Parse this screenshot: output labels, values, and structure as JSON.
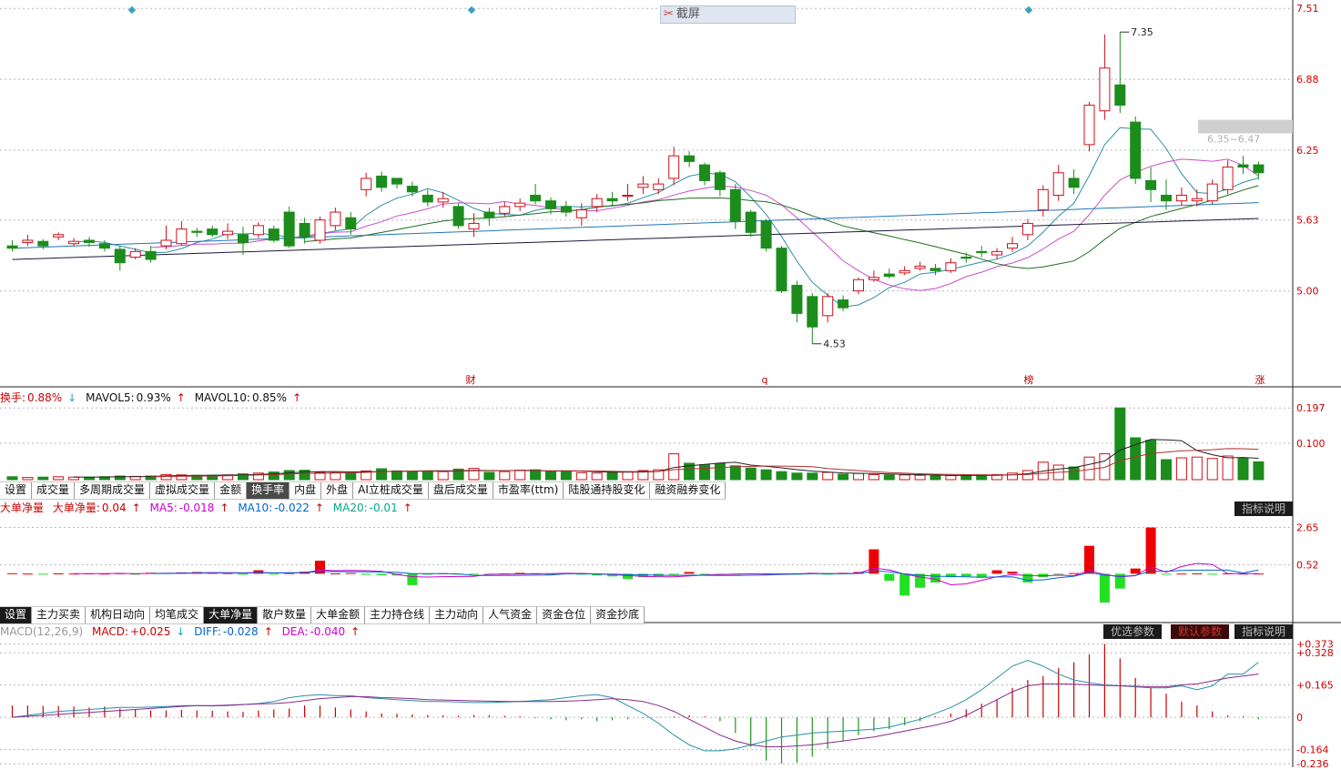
{
  "colors": {
    "up": "#d10f1a",
    "down": "#1c8c1c",
    "ma5": "#2e8fa6",
    "ma10": "#c94fc9",
    "ma20": "#1e6f1e",
    "ma60": "#2276b8",
    "ma120": "#1a1a3a",
    "grid": "#b8b8b8",
    "gray_band": "#cfcfcf"
  },
  "price_panel": {
    "y_ticks": [
      "7.51",
      "6.88",
      "6.25",
      "5.63",
      "5.00"
    ],
    "ylim": [
      4.35,
      7.52
    ],
    "high_label": "7.35",
    "low_label": "4.53",
    "range_label": "6.35~6.47",
    "event_markers": [
      "财",
      "q",
      "榜",
      "涨"
    ],
    "screenshot_button": "截屏"
  },
  "turnover_panel": {
    "legend": {
      "name": "换手:",
      "value": "0.88%",
      "arrow_value": "↓",
      "ma5_label": "MAVOL5:",
      "ma5_value": "0.93%",
      "ma5_arrow": "↑",
      "ma10_label": "MAVOL10:",
      "ma10_value": "0.85%",
      "ma10_arrow": "↑"
    },
    "y_ticks": [
      "0.197",
      "0.100"
    ],
    "ylim": [
      0,
      0.2
    ]
  },
  "tabs1": [
    "设置",
    "成交量",
    "多周期成交量",
    "虚拟成交量",
    "金额",
    "换手率",
    "内盘",
    "外盘",
    "AI立桩成交量",
    "盘后成交量",
    "市盈率(ttm)",
    "陆股通持股变化",
    "融资融券变化"
  ],
  "tabs1_active": 5,
  "netflow_panel": {
    "legend": {
      "name": "大单净量",
      "sub": "大单净量:",
      "value": "0.04",
      "arrow": "↑",
      "ma5_label": "MA5:",
      "ma5_value": "-0.018",
      "ma5_arrow": "↑",
      "ma10_label": "MA10:",
      "ma10_value": "-0.022",
      "ma10_arrow": "↑",
      "ma20_label": "MA20:",
      "ma20_value": "-0.01",
      "ma20_arrow": "↑"
    },
    "y_ticks": [
      "2.65",
      "0.52"
    ],
    "ylim": [
      -1.7,
      3.2
    ],
    "help_button": "指标说明"
  },
  "tabs2": [
    "设置",
    "主力买卖",
    "机构日动向",
    "均笔成交",
    "大单净量",
    "散户数量",
    "大单金额",
    "主力持仓线",
    "主力动向",
    "人气资金",
    "资金仓位",
    "资金抄底"
  ],
  "tabs2_active": 4,
  "macd_panel": {
    "legend": {
      "name": "MACD(12,26,9)",
      "macd_label": "MACD:",
      "macd_value": "+0.025",
      "macd_arrow": "↓",
      "diff_label": "DIFF:",
      "diff_value": "-0.028",
      "diff_arrow": "↑",
      "dea_label": "DEA:",
      "dea_value": "-0.040",
      "dea_arrow": "↑"
    },
    "y_ticks": [
      "+0.373",
      "+0.328",
      "+0.165",
      "0",
      "-0.164",
      "-0.236"
    ],
    "ylim": [
      -0.24,
      0.38
    ],
    "buttons": [
      "优选参数",
      "默认参数",
      "指标说明"
    ]
  },
  "chart_data": {
    "type": "candlestick",
    "x": [
      "d1",
      "d2",
      "d3",
      "d4",
      "d5",
      "d6",
      "d7",
      "d8",
      "d9",
      "d10",
      "d11",
      "d12",
      "d13",
      "d14",
      "d15",
      "d16",
      "d17",
      "d18",
      "d19",
      "d20",
      "d21",
      "d22",
      "d23",
      "d24",
      "d25",
      "d26",
      "d27",
      "d28",
      "d29",
      "d30",
      "d31",
      "d32",
      "d33",
      "d34",
      "d35",
      "d36",
      "d37",
      "d38",
      "d39",
      "d40",
      "d41",
      "d42",
      "d43",
      "d44",
      "d45",
      "d46",
      "d47",
      "d48",
      "d49",
      "d50",
      "d51",
      "d52",
      "d53",
      "d54",
      "d55",
      "d56",
      "d57",
      "d58",
      "d59",
      "d60",
      "d61",
      "d62",
      "d63",
      "d64",
      "d65",
      "d66",
      "d67",
      "d68",
      "d69",
      "d70",
      "d71",
      "d72",
      "d73",
      "d74",
      "d75",
      "d76",
      "d77",
      "d78",
      "d79",
      "d80",
      "d81",
      "d82"
    ],
    "open": [
      5.4,
      5.43,
      5.44,
      5.48,
      5.42,
      5.45,
      5.42,
      5.37,
      5.3,
      5.35,
      5.4,
      5.42,
      5.53,
      5.55,
      5.5,
      5.5,
      5.5,
      5.55,
      5.7,
      5.6,
      5.45,
      5.58,
      5.65,
      5.9,
      6.02,
      6.0,
      5.93,
      5.85,
      5.79,
      5.75,
      5.55,
      5.7,
      5.69,
      5.75,
      5.85,
      5.8,
      5.75,
      5.65,
      5.75,
      5.82,
      5.85,
      5.92,
      5.9,
      6.0,
      6.2,
      6.12,
      6.05,
      5.9,
      5.7,
      5.62,
      5.38,
      5.05,
      4.95,
      4.78,
      4.92,
      5.0,
      5.1,
      5.15,
      5.16,
      5.2,
      5.2,
      5.18,
      5.3,
      5.35,
      5.32,
      5.38,
      5.5,
      5.72,
      5.85,
      6.0,
      6.3,
      6.6,
      6.83,
      6.5,
      5.98,
      5.85,
      5.8,
      5.8,
      5.8,
      5.9,
      6.12,
      6.12
    ],
    "close": [
      5.38,
      5.45,
      5.4,
      5.5,
      5.44,
      5.43,
      5.38,
      5.25,
      5.35,
      5.28,
      5.45,
      5.55,
      5.52,
      5.5,
      5.53,
      5.43,
      5.58,
      5.45,
      5.4,
      5.48,
      5.63,
      5.7,
      5.55,
      6.0,
      5.92,
      5.95,
      5.88,
      5.79,
      5.82,
      5.58,
      5.6,
      5.65,
      5.75,
      5.78,
      5.8,
      5.73,
      5.7,
      5.72,
      5.82,
      5.8,
      5.85,
      5.95,
      5.95,
      6.2,
      6.15,
      5.98,
      5.9,
      5.62,
      5.52,
      5.38,
      5.0,
      4.8,
      4.68,
      4.95,
      4.85,
      5.1,
      5.12,
      5.13,
      5.18,
      5.22,
      5.18,
      5.25,
      5.29,
      5.34,
      5.35,
      5.42,
      5.6,
      5.9,
      6.05,
      5.92,
      6.65,
      6.98,
      6.65,
      6.0,
      5.9,
      5.8,
      5.85,
      5.82,
      5.95,
      6.1,
      6.1,
      6.05
    ],
    "high": [
      5.45,
      5.5,
      5.46,
      5.52,
      5.47,
      5.48,
      5.45,
      5.4,
      5.38,
      5.4,
      5.58,
      5.62,
      5.56,
      5.58,
      5.6,
      5.57,
      5.61,
      5.58,
      5.75,
      5.65,
      5.66,
      5.74,
      5.7,
      6.05,
      6.06,
      6.0,
      5.97,
      5.9,
      5.88,
      5.78,
      5.69,
      5.74,
      5.79,
      5.82,
      5.95,
      5.83,
      5.8,
      5.78,
      5.86,
      5.88,
      5.95,
      6.02,
      6.0,
      6.28,
      6.24,
      6.14,
      6.07,
      5.95,
      5.72,
      5.64,
      5.4,
      5.09,
      4.98,
      4.98,
      4.96,
      5.12,
      5.18,
      5.2,
      5.22,
      5.26,
      5.24,
      5.29,
      5.34,
      5.4,
      5.38,
      5.48,
      5.64,
      5.94,
      6.12,
      6.08,
      6.68,
      7.28,
      7.3,
      6.55,
      6.1,
      5.99,
      5.92,
      5.9,
      5.99,
      6.16,
      6.2,
      6.15
    ],
    "low": [
      5.35,
      5.4,
      5.37,
      5.45,
      5.4,
      5.39,
      5.35,
      5.18,
      5.28,
      5.25,
      5.37,
      5.4,
      5.48,
      5.48,
      5.46,
      5.32,
      5.47,
      5.43,
      5.38,
      5.42,
      5.42,
      5.54,
      5.5,
      5.84,
      5.88,
      5.91,
      5.84,
      5.75,
      5.74,
      5.55,
      5.48,
      5.58,
      5.66,
      5.71,
      5.77,
      5.68,
      5.66,
      5.58,
      5.7,
      5.76,
      5.8,
      5.86,
      5.86,
      5.94,
      6.1,
      5.94,
      5.84,
      5.55,
      5.48,
      5.35,
      4.98,
      4.72,
      4.53,
      4.72,
      4.82,
      4.97,
      5.08,
      5.11,
      5.14,
      5.18,
      5.14,
      5.16,
      5.25,
      5.3,
      5.28,
      5.35,
      5.45,
      5.66,
      5.8,
      5.86,
      6.24,
      6.52,
      6.58,
      5.95,
      5.79,
      5.72,
      5.76,
      5.75,
      5.77,
      5.86,
      6.04,
      5.99
    ],
    "turnover": [
      0.008,
      0.006,
      0.007,
      0.008,
      0.007,
      0.007,
      0.008,
      0.01,
      0.009,
      0.01,
      0.014,
      0.013,
      0.012,
      0.012,
      0.013,
      0.016,
      0.018,
      0.021,
      0.025,
      0.026,
      0.02,
      0.019,
      0.018,
      0.024,
      0.03,
      0.024,
      0.022,
      0.023,
      0.022,
      0.029,
      0.031,
      0.02,
      0.022,
      0.026,
      0.027,
      0.022,
      0.023,
      0.019,
      0.018,
      0.021,
      0.022,
      0.025,
      0.027,
      0.071,
      0.045,
      0.041,
      0.044,
      0.038,
      0.032,
      0.027,
      0.022,
      0.018,
      0.018,
      0.02,
      0.015,
      0.017,
      0.014,
      0.013,
      0.013,
      0.012,
      0.011,
      0.011,
      0.011,
      0.013,
      0.014,
      0.018,
      0.025,
      0.048,
      0.04,
      0.035,
      0.062,
      0.071,
      0.197,
      0.115,
      0.108,
      0.055,
      0.06,
      0.062,
      0.058,
      0.065,
      0.06,
      0.049
    ],
    "netflow": [
      0.03,
      0.01,
      -0.02,
      0.02,
      0.01,
      0.02,
      0.01,
      0.03,
      -0.02,
      0.06,
      0.05,
      0.08,
      0.1,
      0.05,
      0.04,
      -0.02,
      0.2,
      -0.05,
      0.04,
      0.12,
      0.75,
      0.02,
      0.04,
      -0.06,
      -0.08,
      -0.1,
      -0.65,
      -0.05,
      0.03,
      -0.02,
      -0.05,
      -0.06,
      0.02,
      0.05,
      0.03,
      -0.02,
      0.04,
      -0.01,
      -0.1,
      -0.15,
      -0.3,
      -0.2,
      -0.15,
      -0.06,
      0.1,
      -0.05,
      -0.04,
      -0.03,
      0.02,
      0.02,
      0.01,
      -0.03,
      0.05,
      -0.02,
      0.05,
      0.1,
      1.4,
      -0.4,
      -1.25,
      -0.8,
      -0.5,
      -0.2,
      -0.15,
      -0.22,
      0.2,
      0.12,
      -0.5,
      -0.2,
      -0.02,
      0.04,
      1.6,
      -1.65,
      -0.85,
      0.3,
      2.65,
      -0.02,
      0.01,
      0.02,
      -0.01,
      0.02,
      0.01,
      0.01
    ],
    "macd": [
      0.06,
      0.06,
      0.058,
      0.058,
      0.055,
      0.05,
      0.055,
      0.045,
      0.04,
      0.035,
      0.035,
      0.038,
      0.035,
      0.033,
      0.03,
      0.028,
      0.035,
      0.04,
      0.045,
      0.06,
      0.06,
      0.05,
      0.04,
      0.03,
      0.02,
      0.018,
      0.015,
      0.012,
      0.01,
      0.008,
      0.012,
      0.01,
      0.008,
      0.005,
      -0.005,
      -0.01,
      -0.015,
      -0.01,
      -0.02,
      -0.015,
      -0.01,
      -0.005,
      0.002,
      0.005,
      0.01,
      0.005,
      -0.02,
      -0.08,
      -0.15,
      -0.22,
      -0.235,
      -0.23,
      -0.2,
      -0.16,
      -0.12,
      -0.09,
      -0.07,
      -0.06,
      -0.04,
      -0.02,
      0.005,
      0.02,
      0.04,
      0.07,
      0.09,
      0.15,
      0.19,
      0.21,
      0.25,
      0.28,
      0.32,
      0.373,
      0.3,
      0.2,
      0.15,
      0.12,
      0.08,
      0.06,
      0.03,
      0.01,
      0.005,
      -0.01
    ],
    "diff": [
      0.0,
      0.01,
      0.02,
      0.03,
      0.035,
      0.04,
      0.045,
      0.05,
      0.05,
      0.052,
      0.055,
      0.06,
      0.06,
      0.058,
      0.06,
      0.065,
      0.07,
      0.08,
      0.1,
      0.11,
      0.115,
      0.11,
      0.11,
      0.1,
      0.095,
      0.09,
      0.085,
      0.08,
      0.08,
      0.078,
      0.075,
      0.075,
      0.078,
      0.08,
      0.085,
      0.09,
      0.1,
      0.11,
      0.115,
      0.1,
      0.06,
      0.02,
      -0.03,
      -0.09,
      -0.14,
      -0.17,
      -0.17,
      -0.16,
      -0.14,
      -0.12,
      -0.1,
      -0.09,
      -0.08,
      -0.075,
      -0.07,
      -0.065,
      -0.06,
      -0.05,
      -0.03,
      -0.01,
      0.02,
      0.05,
      0.09,
      0.14,
      0.2,
      0.26,
      0.29,
      0.26,
      0.22,
      0.19,
      0.175,
      0.165,
      0.16,
      0.155,
      0.15,
      0.15,
      0.16,
      0.14,
      0.16,
      0.22,
      0.22,
      0.28
    ],
    "dea": [
      0.0,
      0.005,
      0.01,
      0.015,
      0.02,
      0.025,
      0.03,
      0.035,
      0.04,
      0.045,
      0.05,
      0.055,
      0.06,
      0.06,
      0.062,
      0.065,
      0.068,
      0.07,
      0.075,
      0.085,
      0.095,
      0.1,
      0.105,
      0.105,
      0.1,
      0.098,
      0.095,
      0.09,
      0.088,
      0.086,
      0.084,
      0.082,
      0.081,
      0.08,
      0.08,
      0.08,
      0.082,
      0.085,
      0.09,
      0.095,
      0.09,
      0.08,
      0.06,
      0.03,
      -0.01,
      -0.05,
      -0.09,
      -0.12,
      -0.14,
      -0.15,
      -0.15,
      -0.145,
      -0.14,
      -0.13,
      -0.12,
      -0.11,
      -0.1,
      -0.085,
      -0.07,
      -0.055,
      -0.04,
      -0.02,
      0.01,
      0.05,
      0.09,
      0.13,
      0.16,
      0.17,
      0.17,
      0.168,
      0.165,
      0.162,
      0.16,
      0.158,
      0.155,
      0.155,
      0.165,
      0.17,
      0.185,
      0.2,
      0.21,
      0.22
    ]
  }
}
